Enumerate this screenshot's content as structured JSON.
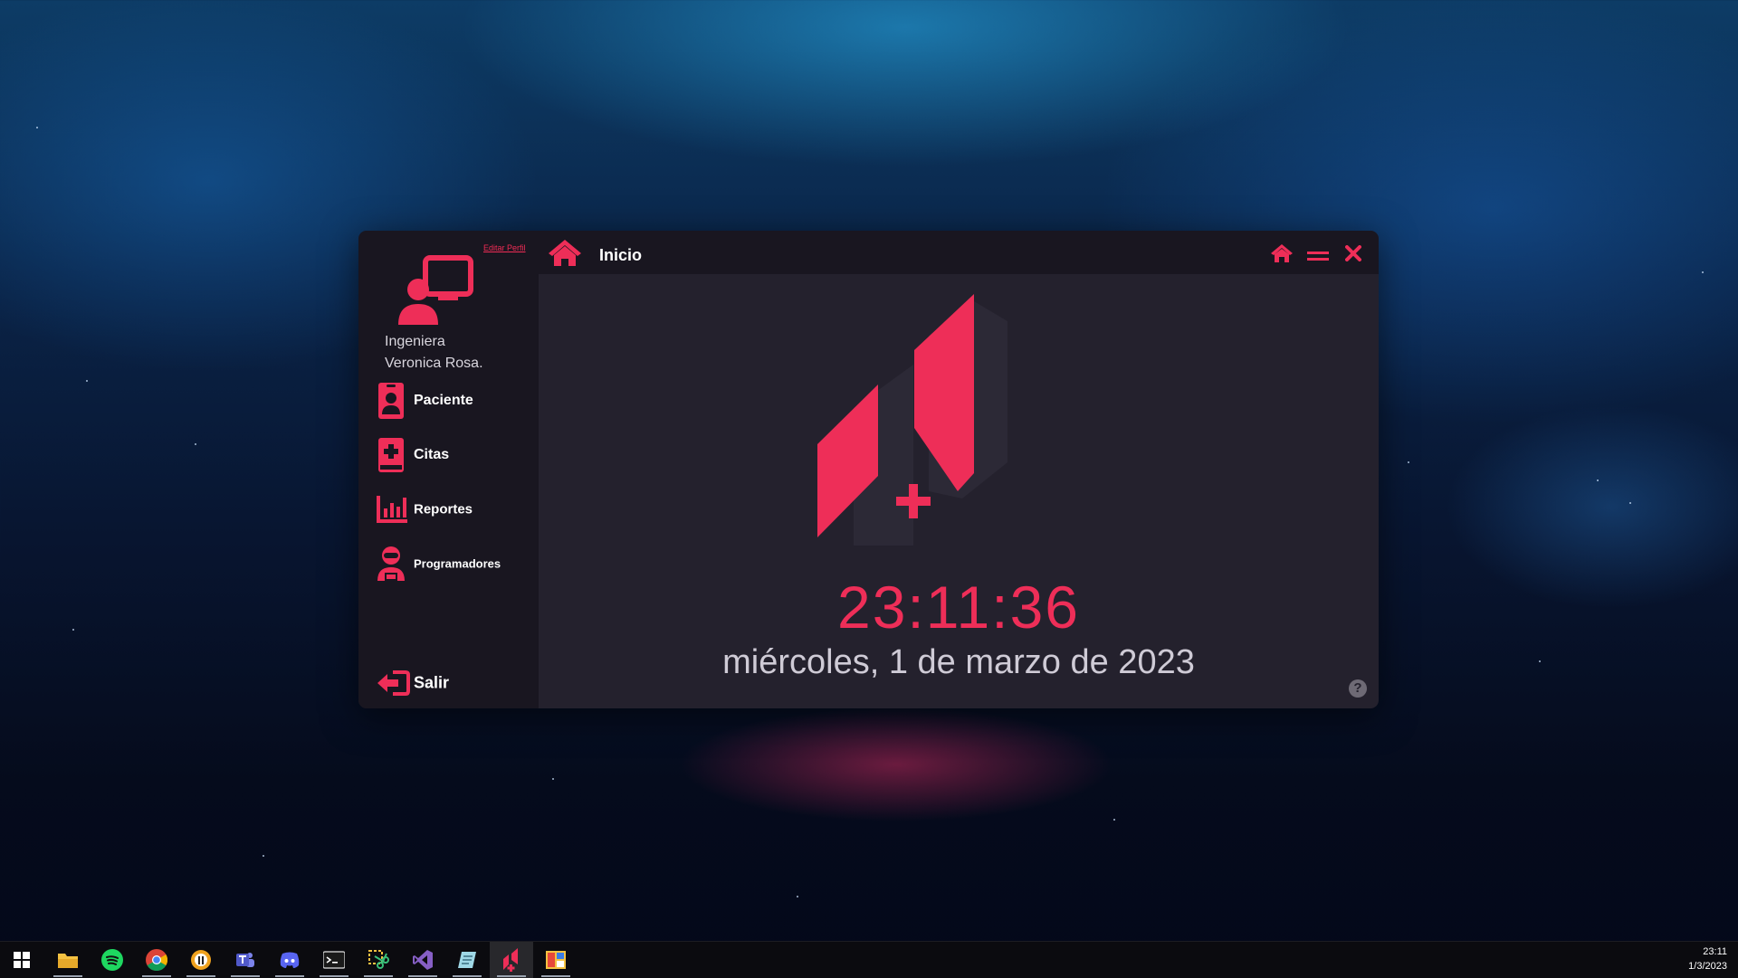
{
  "app": {
    "title": "Inicio",
    "accent_color": "#ee2e58",
    "edit_profile_label": "Editar Perfil",
    "user": {
      "line1": "Ingeniera",
      "line2": "Veronica Rosa."
    },
    "menu": [
      {
        "label": "Paciente",
        "icon": "patient-badge-icon"
      },
      {
        "label": "Citas",
        "icon": "medical-book-icon"
      },
      {
        "label": "Reportes",
        "icon": "bar-chart-icon"
      },
      {
        "label": "Programadores",
        "icon": "programmer-icon"
      }
    ],
    "exit_label": "Salir",
    "clock": "23:11:36",
    "date": "miércoles, 1 de marzo de 2023",
    "help_symbol": "?"
  },
  "taskbar": {
    "time": "23:11",
    "date": "1/3/2023",
    "apps": [
      "windows-start",
      "file-explorer",
      "spotify",
      "chrome",
      "app-circle",
      "teams",
      "discord",
      "terminal",
      "snipping-tool",
      "visual-studio",
      "notes",
      "medical-app",
      "photo-viewer"
    ]
  }
}
